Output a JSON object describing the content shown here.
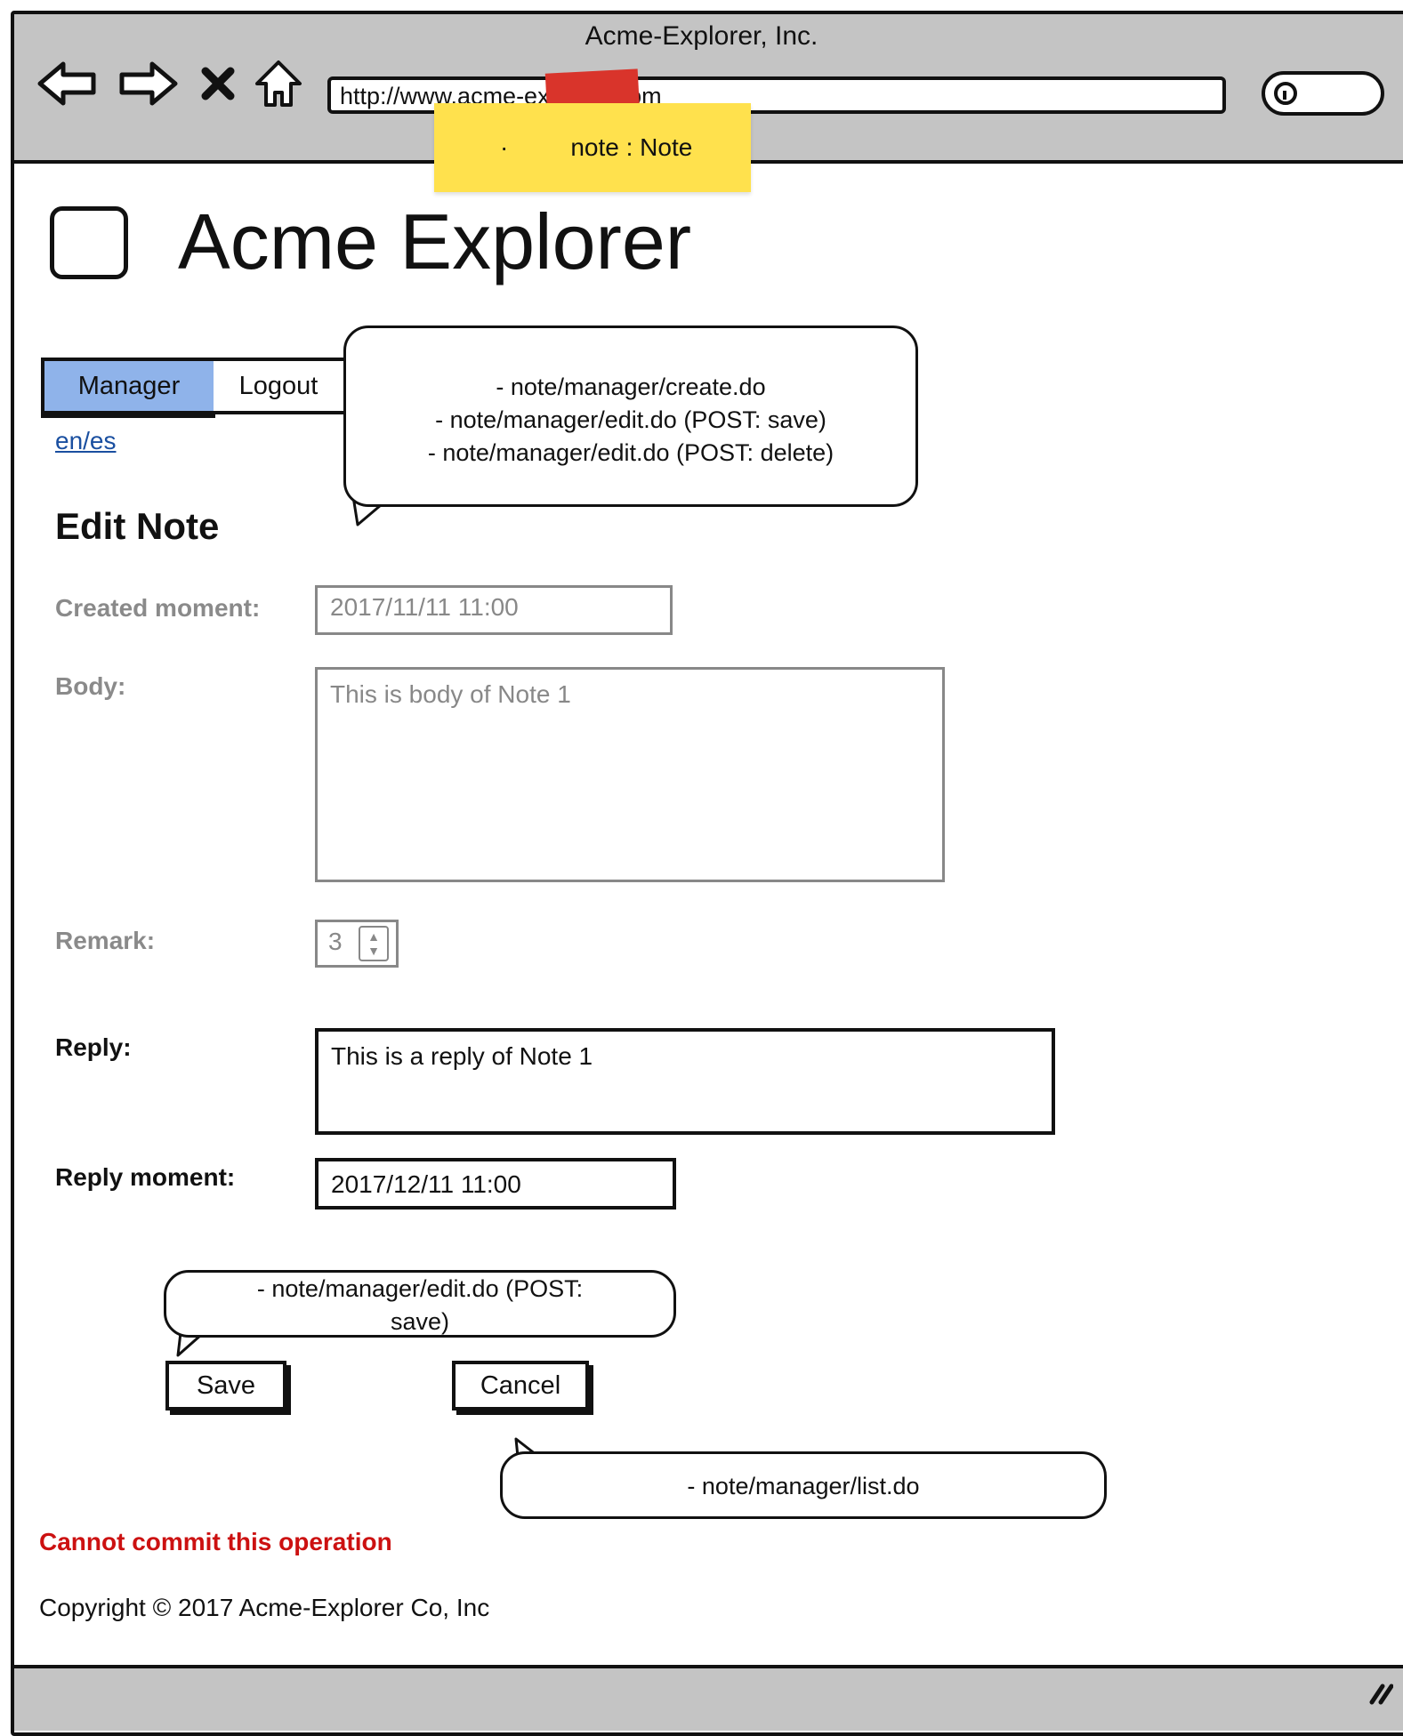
{
  "window": {
    "title": "Acme-Explorer, Inc."
  },
  "browser": {
    "url": "http://www.acme-explorer.com",
    "nav_icons": [
      "back-arrow-icon",
      "forward-arrow-icon",
      "stop-x-icon",
      "home-icon"
    ],
    "search_icon": "search-icon"
  },
  "sticky_note": {
    "bullet": "·",
    "text": "note : Note"
  },
  "header": {
    "title": "Acme Explorer"
  },
  "menu": {
    "tabs": [
      "Manager",
      "Logout"
    ]
  },
  "lang_link": "en/es",
  "callouts": {
    "top": [
      "- note/manager/create.do",
      "- note/manager/edit.do (POST: save)",
      "- note/manager/edit.do (POST: delete)"
    ],
    "save": [
      "- note/manager/edit.do (POST:",
      "save)"
    ],
    "cancel": [
      "- note/manager/list.do"
    ]
  },
  "form": {
    "title": "Edit Note",
    "created_label": "Created moment:",
    "created_value": "2017/11/11 11:00",
    "body_label": "Body:",
    "body_value": "This is body of Note 1",
    "remark_label": "Remark:",
    "remark_value": "3",
    "reply_label": "Reply:",
    "reply_value": "This is a reply of Note 1",
    "reply_moment_label": "Reply moment:",
    "reply_moment_value": "2017/12/11 11:00"
  },
  "buttons": {
    "save": "Save",
    "cancel": "Cancel"
  },
  "error": "Cannot commit this operation",
  "footer": {
    "copyright": "Copyright © 2017 Acme-Explorer Co, Inc"
  },
  "colors": {
    "chrome": "#c4c4c4",
    "active_tab": "#8fb3ea",
    "sticky": "#ffe14d",
    "tape": "#d9342b",
    "error": "#cc1111",
    "link": "#1a4fa0"
  }
}
